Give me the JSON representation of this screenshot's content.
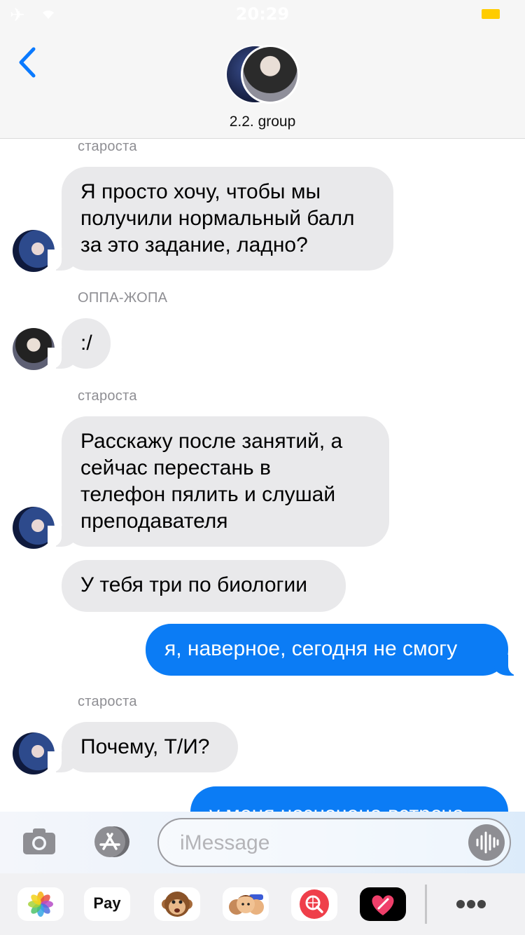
{
  "status_bar": {
    "time": "20:29"
  },
  "header": {
    "title": "2.2. group"
  },
  "messages": [
    {
      "sender": "староста",
      "lines": [
        "Я просто хочу, чтобы мы",
        "получили нормальный балл",
        "за это задание, ладно?"
      ]
    },
    {
      "sender": "ОППА-ЖОПА",
      "lines": [
        ":/"
      ]
    },
    {
      "sender": "староста",
      "lines": [
        "Расскажу после занятий, а",
        "сейчас перестань в",
        "телефон пялить и слушай",
        "преподавателя"
      ]
    },
    {
      "lines": [
        "У тебя три по биологии"
      ]
    },
    {
      "outgoing": true,
      "lines": [
        "я, наверное, сегодня не смогу"
      ]
    },
    {
      "sender": "староста",
      "lines": [
        "Почему, Т/И?"
      ]
    },
    {
      "outgoing": true,
      "lines": [
        "у меня назначена встреча"
      ]
    }
  ],
  "input": {
    "placeholder": "iMessage"
  },
  "apps": [
    {
      "name": "photos-icon",
      "label": ""
    },
    {
      "name": "apple-pay-icon",
      "label": "Pay"
    },
    {
      "name": "monkey-animoji-icon",
      "label": ""
    },
    {
      "name": "memoji-icon",
      "label": ""
    },
    {
      "name": "web-search-icon",
      "label": ""
    },
    {
      "name": "digital-touch-icon",
      "label": ""
    },
    {
      "name": "more-apps-icon",
      "label": ""
    }
  ],
  "colors": {
    "incoming": "#e9e9eb",
    "outgoing": "#0b7cf5",
    "accent": "#0a7aff"
  }
}
